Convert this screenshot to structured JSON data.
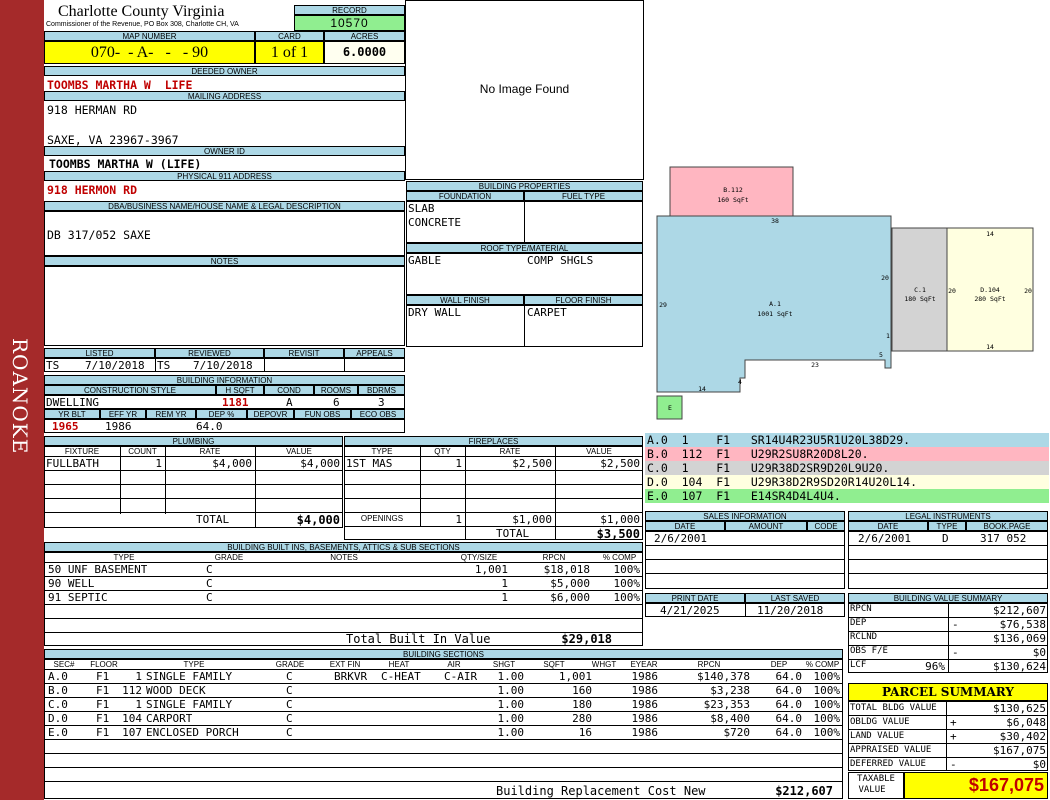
{
  "sidebar_label": "ROANOKE",
  "county": {
    "name": "Charlotte County Virginia",
    "address": "Commissioner of the Revenue, PO Box 308, Charlotte CH, VA"
  },
  "record": {
    "label": "RECORD",
    "value": "10570"
  },
  "map": {
    "label": "MAP NUMBER",
    "value": "070-  - A-   -   - 90"
  },
  "card": {
    "label": "CARD",
    "value": "1 of 1"
  },
  "acres": {
    "label": "ACRES",
    "value": "6.0000"
  },
  "deeded_owner": {
    "label": "DEEDED OWNER",
    "value": "TOOMBS MARTHA W  LIFE"
  },
  "mailing": {
    "label": "MAILING ADDRESS",
    "line1": "918 HERMAN RD",
    "line2": "SAXE, VA 23967-3967"
  },
  "owner_id": {
    "label": "OWNER ID",
    "value": "TOOMBS MARTHA W (LIFE)"
  },
  "physical": {
    "label": "PHYSICAL 911 ADDRESS",
    "value": "918 HERMON RD"
  },
  "dba": {
    "label": "DBA/BUSINESS NAME/HOUSE NAME & LEGAL DESCRIPTION",
    "value": "DB 317/052 SAXE"
  },
  "notes": {
    "label": "NOTES"
  },
  "listed": {
    "label": "LISTED",
    "by": "TS",
    "date": "7/10/2018"
  },
  "reviewed": {
    "label": "REVIEWED",
    "by": "TS",
    "date": "7/10/2018"
  },
  "revisit": {
    "label": "REVISIT"
  },
  "appeals": {
    "label": "APPEALS"
  },
  "building_info": {
    "label": "BUILDING INFORMATION",
    "h1": {
      "style": "CONSTRUCTION STYLE",
      "hsqft": "H SQFT",
      "cond": "COND",
      "rooms": "ROOMS",
      "bdrms": "BDRMS"
    },
    "style": "DWELLING",
    "hsqft": "1181",
    "cond": "A",
    "rooms": "6",
    "bdrms": "3",
    "h2": {
      "yrblt": "YR BLT",
      "effyr": "EFF YR",
      "remyr": "REM YR",
      "dep": "DEP %",
      "depovr": "DEPOVR",
      "funobs": "FUN OBS",
      "ecoobs": "ECO OBS"
    },
    "yrblt": "1965",
    "effyr": "1986",
    "dep": "64.0"
  },
  "image_placeholder": "No Image Found",
  "building_props": {
    "label": "BUILDING PROPERTIES",
    "foundation_label": "FOUNDATION",
    "fuel_label": "FUEL TYPE",
    "foundation1": "SLAB",
    "foundation2": "CONCRETE",
    "roof_label": "ROOF TYPE/MATERIAL",
    "roof_type": "GABLE",
    "roof_material": "COMP SHGLS",
    "wall_label": "WALL FINISH",
    "floor_label": "FLOOR FINISH",
    "wall": "DRY WALL",
    "floor": "CARPET"
  },
  "sketch": {
    "areas": [
      {
        "name": "A.1",
        "sqft": "1001 SqFt"
      },
      {
        "name": "B.112",
        "sqft": "160 SqFt"
      },
      {
        "name": "C.1",
        "sqft": "180 SqFt"
      },
      {
        "name": "D.104",
        "sqft": "280 SqFt"
      },
      {
        "name": "E",
        "sqft": ""
      }
    ],
    "dims": [
      "38",
      "20",
      "29",
      "14",
      "4",
      "23",
      "5",
      "1",
      "20",
      "20",
      "14",
      "14"
    ],
    "colors": {
      "A": "#add8e6",
      "B": "#ffb6c1",
      "C": "#d3d3d3",
      "D": "#ffffe0",
      "E": "#90ee90"
    }
  },
  "segments": [
    {
      "text": "A.0  1    F1   SR14U4R23U5R1U20L38D29.",
      "color": "#add8e6"
    },
    {
      "text": "B.0  112  F1   U29R2SU8R20D8L20.",
      "color": "#ffb6c1"
    },
    {
      "text": "C.0  1    F1   U29R38D2SR9D20L9U20.",
      "color": "#d3d3d3"
    },
    {
      "text": "D.0  104  F1   U29R38D2R9SD20R14U20L14.",
      "color": "#ffffe0"
    },
    {
      "text": "E.0  107  F1   E14SR4D4L4U4.",
      "color": "#90ee90"
    }
  ],
  "plumbing": {
    "label": "PLUMBING",
    "headers": [
      "FIXTURE",
      "COUNT",
      "RATE",
      "VALUE"
    ],
    "rows": [
      {
        "fixture": "FULLBATH",
        "count": "1",
        "rate": "$4,000",
        "value": "$4,000"
      }
    ],
    "total_label": "TOTAL",
    "total": "$4,000"
  },
  "fireplaces": {
    "label": "FIREPLACES",
    "headers": [
      "TYPE",
      "QTY",
      "RATE",
      "VALUE"
    ],
    "rows": [
      {
        "type": "1ST MAS",
        "qty": "1",
        "rate": "$2,500",
        "value": "$2,500"
      }
    ],
    "openings_label": "OPENINGS",
    "openings_qty": "1",
    "openings_rate": "$1,000",
    "openings_value": "$1,000",
    "total_label": "TOTAL",
    "total": "$3,500"
  },
  "sales": {
    "label": "SALES INFORMATION",
    "headers": [
      "DATE",
      "AMOUNT",
      "CODE"
    ],
    "date": "2/6/2001"
  },
  "legal": {
    "label": "LEGAL INSTRUMENTS",
    "headers": [
      "DATE",
      "TYPE",
      "BOOK.PAGE"
    ],
    "date": "2/6/2001",
    "type": "D",
    "book": "317 052"
  },
  "builtins": {
    "label": "BUILDING BUILT INS, BASEMENTS, ATTICS & SUB SECTIONS",
    "headers": [
      "TYPE",
      "GRADE",
      "NOTES",
      "QTY/SIZE",
      "RPCN",
      "% COMP"
    ],
    "rows": [
      {
        "type": "50 UNF BASEMENT",
        "grade": "C",
        "qty": "1,001",
        "rpcn": "$18,018",
        "comp": "100%"
      },
      {
        "type": "90 WELL",
        "grade": "C",
        "qty": "1",
        "rpcn": "$5,000",
        "comp": "100%"
      },
      {
        "type": "91 SEPTIC",
        "grade": "C",
        "qty": "1",
        "rpcn": "$6,000",
        "comp": "100%"
      }
    ],
    "total_label": "Total Built In Value",
    "total": "$29,018"
  },
  "print": {
    "label": "PRINT DATE",
    "value": "4/21/2025"
  },
  "saved": {
    "label": "LAST SAVED",
    "value": "11/20/2018"
  },
  "value_summary": {
    "label": "BUILDING VALUE SUMMARY",
    "rows": [
      {
        "label": "RPCN",
        "op": "",
        "value": "$212,607"
      },
      {
        "label": "DEP",
        "op": "-",
        "value": "$76,538"
      },
      {
        "label": "RCLND",
        "op": "",
        "value": "$136,069"
      },
      {
        "label": "OBS F/E",
        "op": "-",
        "value": "$0"
      },
      {
        "label": "LCF",
        "op": "",
        "value": "$130,624",
        "pct": "96%"
      }
    ]
  },
  "sections": {
    "label": "BUILDING SECTIONS",
    "headers": [
      "SEC#",
      "FLOOR",
      "TYPE",
      "GRADE",
      "EXT FIN",
      "HEAT",
      "AIR",
      "SHGT",
      "SQFT",
      "WHGT",
      "EYEAR",
      "RPCN",
      "DEP",
      "% COMP"
    ],
    "rows": [
      {
        "sec": "A.0",
        "floor": "F1",
        "code": "1",
        "type": "SINGLE FAMILY",
        "grade": "C",
        "ext": "BRKVR",
        "heat": "C-HEAT",
        "air": "C-AIR",
        "shgt": "1.00",
        "sqft": "1,001",
        "eyear": "1986",
        "rpcn": "$140,378",
        "dep": "64.0",
        "comp": "100%"
      },
      {
        "sec": "B.0",
        "floor": "F1",
        "code": "112",
        "type": "WOOD DECK",
        "grade": "C",
        "ext": "",
        "heat": "",
        "air": "",
        "shgt": "1.00",
        "sqft": "160",
        "eyear": "1986",
        "rpcn": "$3,238",
        "dep": "64.0",
        "comp": "100%"
      },
      {
        "sec": "C.0",
        "floor": "F1",
        "code": "1",
        "type": "SINGLE FAMILY",
        "grade": "C",
        "ext": "",
        "heat": "",
        "air": "",
        "shgt": "1.00",
        "sqft": "180",
        "eyear": "1986",
        "rpcn": "$23,353",
        "dep": "64.0",
        "comp": "100%"
      },
      {
        "sec": "D.0",
        "floor": "F1",
        "code": "104",
        "type": "CARPORT",
        "grade": "C",
        "ext": "",
        "heat": "",
        "air": "",
        "shgt": "1.00",
        "sqft": "280",
        "eyear": "1986",
        "rpcn": "$8,400",
        "dep": "64.0",
        "comp": "100%"
      },
      {
        "sec": "E.0",
        "floor": "F1",
        "code": "107",
        "type": "ENCLOSED PORCH",
        "grade": "C",
        "ext": "",
        "heat": "",
        "air": "",
        "shgt": "1.00",
        "sqft": "16",
        "eyear": "1986",
        "rpcn": "$720",
        "dep": "64.0",
        "comp": "100%"
      }
    ],
    "total_label": "Building Replacement Cost New",
    "total": "$212,607"
  },
  "parcel": {
    "label": "PARCEL SUMMARY",
    "rows": [
      {
        "label": "TOTAL BLDG VALUE",
        "op": "",
        "value": "$130,625"
      },
      {
        "label": "OBLDG VALUE",
        "op": "+",
        "value": "$6,048"
      },
      {
        "label": "LAND VALUE",
        "op": "+",
        "value": "$30,402"
      },
      {
        "label": "APPRAISED VALUE",
        "op": "",
        "value": "$167,075"
      },
      {
        "label": "DEFERRED VALUE",
        "op": "-",
        "value": "$0"
      }
    ],
    "taxable_label1": "TAXABLE",
    "taxable_label2": "VALUE",
    "taxable": "$167,075"
  }
}
